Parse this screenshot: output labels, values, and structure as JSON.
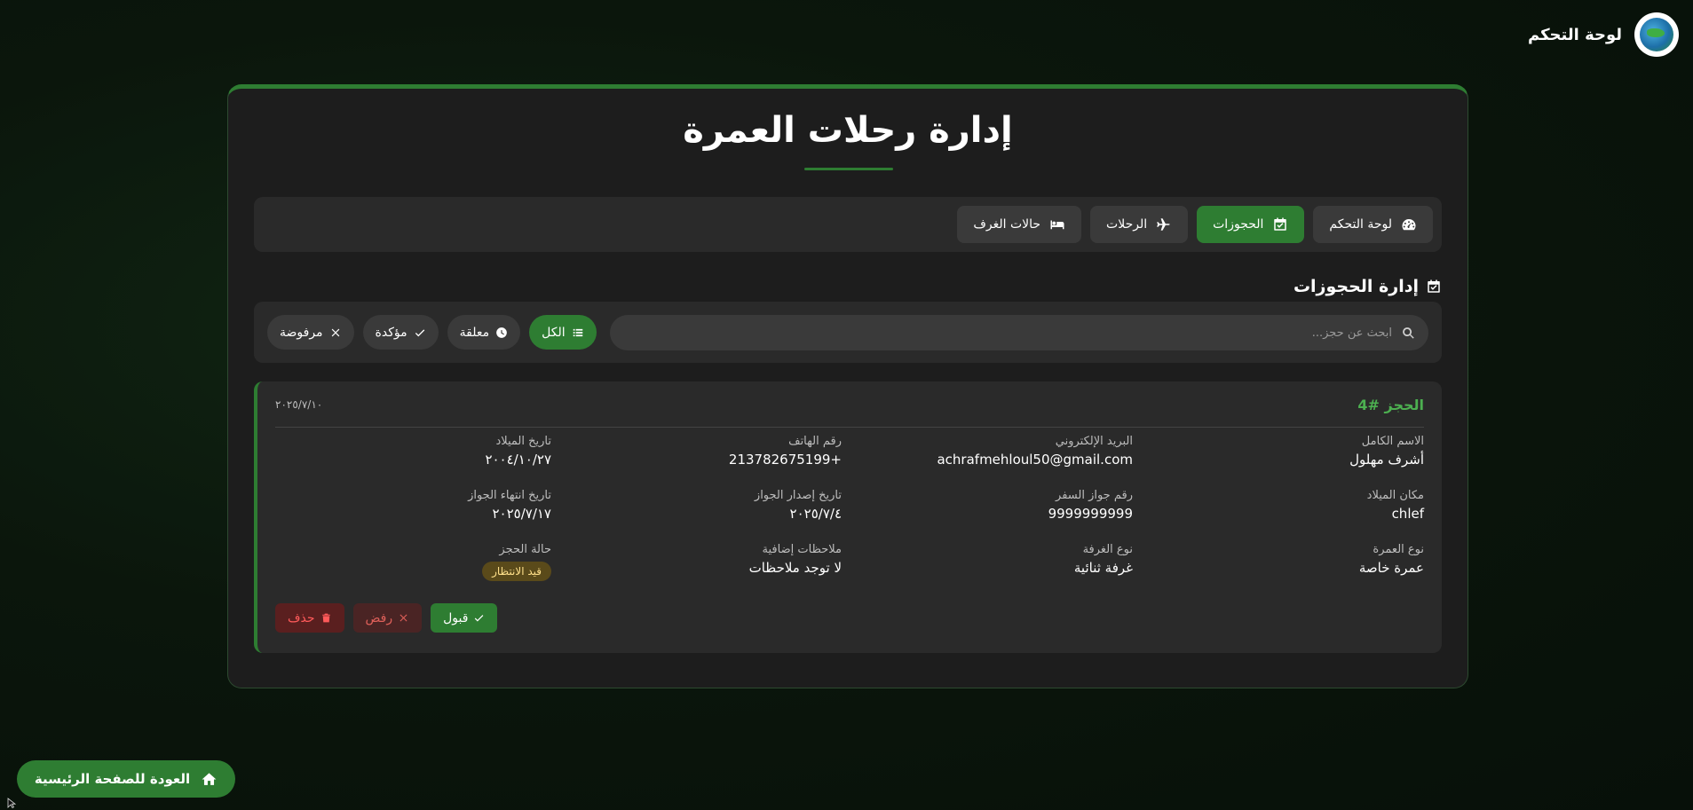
{
  "brand": {
    "title": "لوحة التحكم",
    "logo_icon": "agency-logo-icon"
  },
  "page": {
    "title": "إدارة رحلات العمرة"
  },
  "nav": {
    "items": [
      {
        "label": "لوحة التحكم",
        "icon": "dashboard-gauge-icon",
        "active": false
      },
      {
        "label": "الحجوزات",
        "icon": "calendar-check-icon",
        "active": true
      },
      {
        "label": "الرحلات",
        "icon": "plane-icon",
        "active": false
      },
      {
        "label": "حالات الغرف",
        "icon": "bed-icon",
        "active": false
      }
    ]
  },
  "section": {
    "title": "إدارة الحجوزات",
    "icon": "calendar-check-icon"
  },
  "search": {
    "placeholder": "ابحث عن حجز...",
    "value": ""
  },
  "filters": {
    "all": "الكل",
    "pending": "معلقة",
    "confirmed": "مؤكدة",
    "rejected": "مرفوضة",
    "active": "all"
  },
  "booking": {
    "title": "الحجز #4",
    "date": "٢٠٢٥/٧/١٠",
    "fields": {
      "full_name": {
        "label": "الاسم الكامل",
        "value": "أشرف مهلول"
      },
      "email": {
        "label": "البريد الإلكتروني",
        "value": "achrafmehloul50@gmail.com"
      },
      "phone": {
        "label": "رقم الهاتف",
        "value": "213782675199+"
      },
      "birth_date": {
        "label": "تاريخ الميلاد",
        "value": "٢٠٠٤/١٠/٢٧"
      },
      "birth_place": {
        "label": "مكان الميلاد",
        "value": "chlef"
      },
      "passport_no": {
        "label": "رقم جواز السفر",
        "value": "9999999999"
      },
      "passport_issue": {
        "label": "تاريخ إصدار الجواز",
        "value": "٢٠٢٥/٧/٤"
      },
      "passport_expiry": {
        "label": "تاريخ انتهاء الجواز",
        "value": "٢٠٢٥/٧/١٧"
      },
      "umrah_type": {
        "label": "نوع العمرة",
        "value": "عمرة خاصة"
      },
      "room_type": {
        "label": "نوع الغرفة",
        "value": "غرفة ثنائية"
      },
      "notes": {
        "label": "ملاحظات إضافية",
        "value": "لا توجد ملاحظات"
      },
      "status": {
        "label": "حالة الحجز",
        "value": "قيد الانتظار"
      }
    },
    "actions": {
      "accept": "قبول",
      "reject": "رفض",
      "delete": "حذف"
    }
  },
  "footer": {
    "home_label": "العودة للصفحة الرئيسية",
    "home_icon": "home-icon"
  },
  "colors": {
    "accent": "#2e7d32",
    "accent_text": "#4caf50",
    "panel": "#1d1d1d",
    "card": "#2a2a2a",
    "pending_badge_bg": "#5a4a1a",
    "danger": "#ff5a5a"
  }
}
